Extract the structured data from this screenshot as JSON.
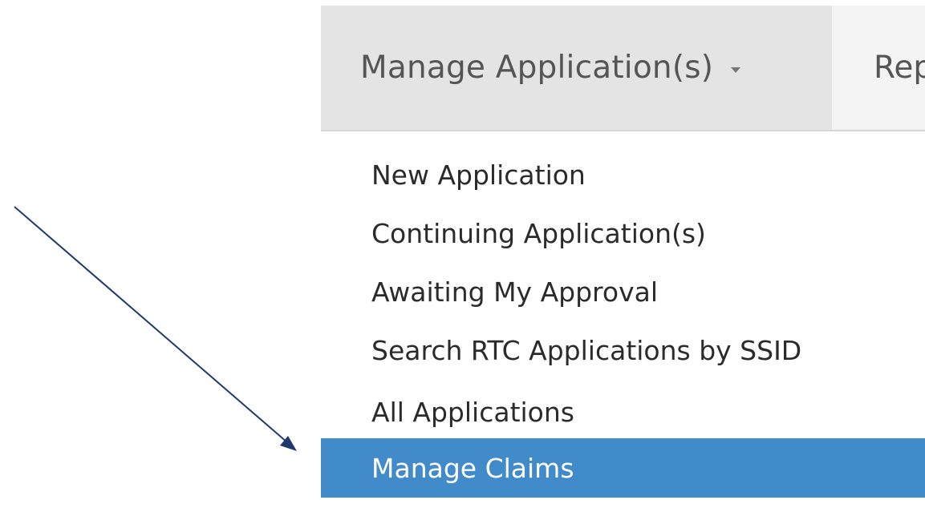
{
  "nav": {
    "active_tab": "Manage Application(s)",
    "next_tab_partial": "Rep",
    "caret_icon": "caret-down-icon"
  },
  "menu": {
    "items": [
      {
        "label": "New Application",
        "active": false
      },
      {
        "label": "Continuing Application(s)",
        "active": false
      },
      {
        "label": "Awaiting My Approval",
        "active": false
      },
      {
        "label": "Search RTC Applications by SSID",
        "active": false
      },
      {
        "label": "All Applications",
        "active": false
      },
      {
        "label": "Manage Claims",
        "active": true
      }
    ]
  },
  "annotation": {
    "arrow_icon": "pointer-arrow-icon"
  },
  "colors": {
    "active_item_bg": "#428bca",
    "active_item_text": "#ffffff",
    "arrow": "#1f3a6e",
    "nav_bg": "#f4f4f4",
    "active_tab_bg": "#e4e4e4"
  }
}
